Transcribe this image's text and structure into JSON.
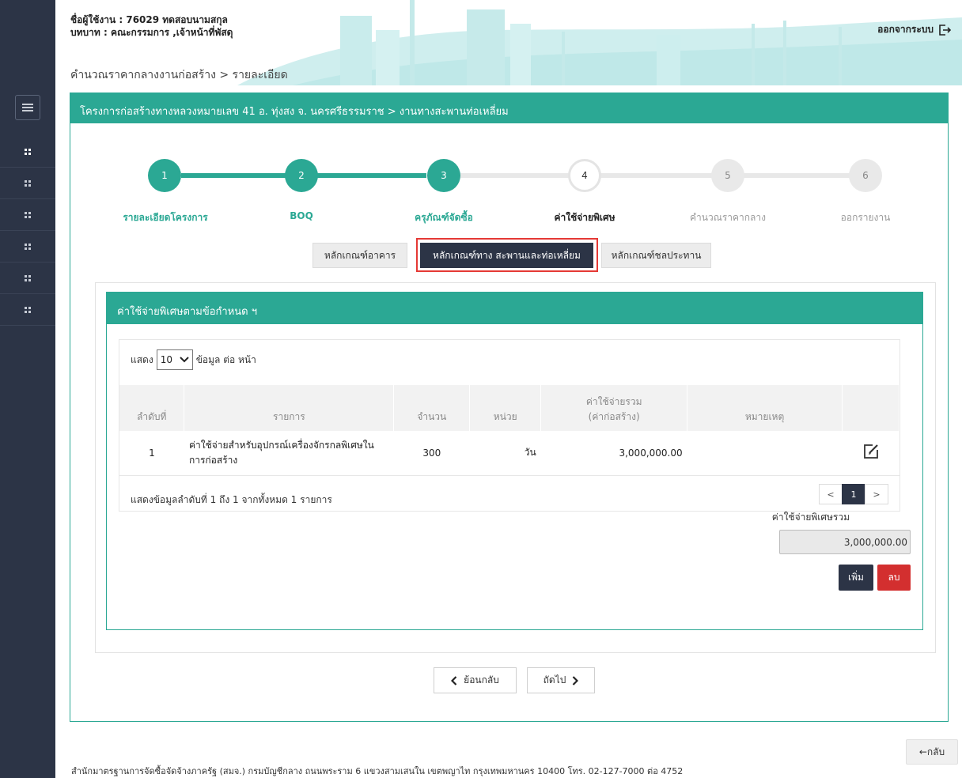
{
  "header": {
    "user_line": "ชื่อผู้ใช้งาน : 76029 ทดสอบนามสกุล",
    "role_line": "บทบาท : คณะกรรมการ ,เจ้าหน้าที่พัสดุ",
    "breadcrumb": "คำนวณราคากลางงานก่อสร้าง > รายละเอียด",
    "logout_label": "ออกจากระบบ"
  },
  "sidebar": {
    "menu_icon": "hamburger-icon",
    "item_icon": "grid-icon",
    "items": [
      "menu-1",
      "menu-2",
      "menu-3",
      "menu-4",
      "menu-5",
      "menu-6"
    ]
  },
  "panel": {
    "title": "โครงการก่อสร้างทางหลวงหมายเลข 41 อ. ทุ่งสง จ. นครศรีธรรมราช > งานทางสะพานท่อเหลี่ยม"
  },
  "stepper": {
    "steps": [
      {
        "number": "1",
        "label": "รายละเอียดโครงการ",
        "state": "done"
      },
      {
        "number": "2",
        "label": "BOQ",
        "state": "done"
      },
      {
        "number": "3",
        "label": "ครุภัณฑ์จัดซื้อ",
        "state": "done"
      },
      {
        "number": "4",
        "label": "ค่าใช้จ่ายพิเศษ",
        "state": "current"
      },
      {
        "number": "5",
        "label": "คำนวณราคากลาง",
        "state": "todo"
      },
      {
        "number": "6",
        "label": "ออกรายงาน",
        "state": "todo"
      }
    ]
  },
  "criteria_tabs": [
    {
      "label": "หลักเกณฑ์อาคาร",
      "active": false
    },
    {
      "label": "หลักเกณฑ์ทาง สะพานและท่อเหลี่ยม",
      "active": true
    },
    {
      "label": "หลักเกณฑ์ชลประทาน",
      "active": false
    }
  ],
  "special_costs": {
    "title": "ค่าใช้จ่ายพิเศษตามข้อกำหนด ฯ",
    "length_prefix": "แสดง",
    "length_value": "10",
    "length_suffix": "ข้อมูล ต่อ หน้า",
    "columns": [
      "ลำดับที่",
      "รายการ",
      "จำนวน",
      "หน่วย",
      "ค่าใช้จ่ายรวม",
      "(ค่าก่อสร้าง)",
      "หมายเหตุ",
      ""
    ],
    "rows": [
      {
        "no": "1",
        "item_line1": "ค่าใช้จ่ายสำหรับอุปกรณ์เครื่องจักรกลพิเศษใน",
        "item_line2": "การก่อสร้าง",
        "quantity": "300",
        "unit": "วัน",
        "total": "3,000,000.00",
        "remark": ""
      }
    ],
    "info": "แสดงข้อมูลลำดับที่ 1 ถึง 1 จากทั้งหมด 1 รายการ",
    "pager": {
      "prev": "<",
      "current": "1",
      "next": ">"
    },
    "total_label": "ค่าใช้จ่ายพิเศษรวม",
    "total_value": "3,000,000.00",
    "add_label": "เพิ่ม",
    "delete_label": "ลบ"
  },
  "navigation": {
    "back_label": "ย้อนกลับ",
    "next_label": "ถัดไป"
  },
  "page_back_label": "←กลับ",
  "footer": "สำนักมาตรฐานการจัดซื้อจัดจ้างภาครัฐ (สมจ.) กรมบัญชีกลาง ถนนพระราม 6 แขวงสามเสนใน เขตพญาไท กรุงเทพมหานคร 10400 โทร. 02-127-7000 ต่อ 4752",
  "colors": {
    "accent": "#2ba894",
    "sidebar": "#2c3446",
    "danger": "#d32f2f",
    "highlight": "#e53935"
  }
}
